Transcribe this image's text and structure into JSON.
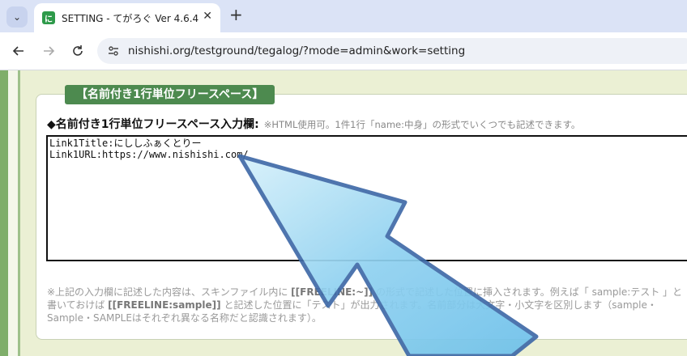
{
  "browser": {
    "tab": {
      "favicon_text": "に",
      "title": "SETTING - てがろぐ Ver 4.6.4",
      "close": "✕"
    },
    "new_tab": "+",
    "url": "nishishi.org/testground/tegalog/?mode=admin&work=setting"
  },
  "section": {
    "title": "【名前付き1行単位フリースペース】",
    "field_label": "◆名前付き1行単位フリースペース入力欄:",
    "field_note": "※HTML使用可。1件1行「name:中身」の形式でいくつでも記述できます。",
    "textarea_value": "Link1Title:にししふぁくとりー\nLink1URL:https://www.nishishi.com/",
    "help": {
      "part1": "※上記の入力欄に記述した内容は、スキンファイル内に ",
      "code1": "[[FREELINE:~]]",
      "part2": " の形式で記述した位置に挿入されます。例えば「 sample:テスト 」と書いておけば ",
      "code2": "[[FREELINE:sample]]",
      "part3": " と記述した位置に「テスト」が出力されます。名前部分は大文字・小文字を区別します（sample・Sample・SAMPLEはそれぞれ異なる名称だと認識されます）。"
    }
  },
  "colors": {
    "accent_green": "#4d8a4f",
    "page_bg": "#ebf0d4",
    "arrow_blue": "#8fd1f0"
  }
}
